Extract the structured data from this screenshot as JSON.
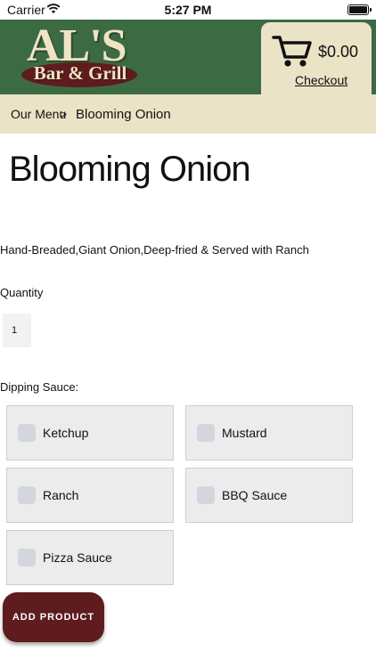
{
  "status_bar": {
    "carrier": "Carrier",
    "time": "5:27 PM"
  },
  "header": {
    "logo_main": "AL'S",
    "logo_sub": "Bar & Grill",
    "cart_total": "$0.00",
    "checkout_label": "Checkout"
  },
  "breadcrumb": {
    "menu": "Our Menu",
    "separator": ">",
    "current": "Blooming Onion"
  },
  "product": {
    "title": "Blooming Onion",
    "description": "Hand-Breaded,Giant Onion,Deep-fried & Served with Ranch",
    "quantity_label": "Quantity",
    "quantity_value": "1"
  },
  "dipping": {
    "label": "Dipping Sauce:",
    "options": [
      "Ketchup",
      "Mustard",
      "Ranch",
      "BBQ Sauce",
      "Pizza Sauce"
    ]
  },
  "actions": {
    "add_product": "ADD PRODUCT"
  },
  "colors": {
    "header_green": "#3c6b43",
    "cream": "#ebe3c6",
    "maroon": "#5e1c1f"
  }
}
